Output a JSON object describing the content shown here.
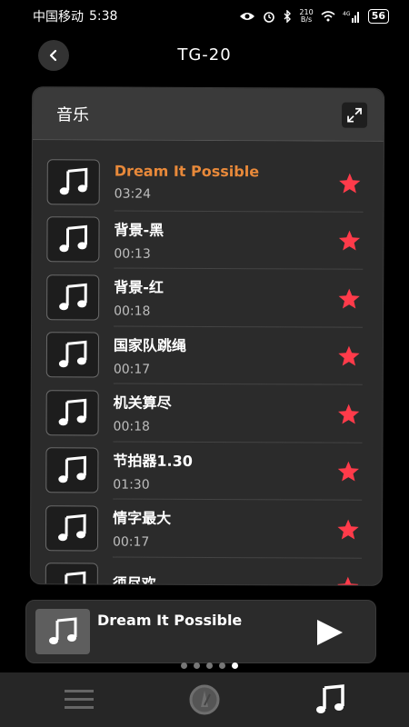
{
  "status_bar": {
    "carrier": "中国移动",
    "time": "5:38",
    "net_speed_value": "210",
    "net_speed_unit": "B/s",
    "battery": "56"
  },
  "header": {
    "title": "TG-20"
  },
  "music_card": {
    "title": "音乐",
    "tracks": [
      {
        "name": "Dream It Possible",
        "duration": "03:24",
        "active": true,
        "favorite": true
      },
      {
        "name": "背景-黑",
        "duration": "00:13",
        "active": false,
        "favorite": true
      },
      {
        "name": "背景-红",
        "duration": "00:18",
        "active": false,
        "favorite": true
      },
      {
        "name": "国家队跳绳",
        "duration": "00:17",
        "active": false,
        "favorite": true
      },
      {
        "name": "机关算尽",
        "duration": "00:18",
        "active": false,
        "favorite": true
      },
      {
        "name": "节拍器1.30",
        "duration": "01:30",
        "active": false,
        "favorite": true
      },
      {
        "name": "情字最大",
        "duration": "00:17",
        "active": false,
        "favorite": true
      },
      {
        "name": "须尽欢",
        "duration": "",
        "active": false,
        "favorite": true
      }
    ]
  },
  "player": {
    "now_playing": "Dream It Possible"
  },
  "pager": {
    "count": 5,
    "active_index": 4
  },
  "colors": {
    "accent": "#e8893a",
    "star": "#ff3b4a",
    "card_bg": "#2b2b2b"
  },
  "icons": {
    "back": "chevron-left-icon",
    "expand": "expand-icon",
    "track": "music-note-icon",
    "favorite": "star-icon",
    "play": "play-icon",
    "nav": [
      "menu-icon",
      "metronome-icon",
      "music-note-icon"
    ]
  }
}
